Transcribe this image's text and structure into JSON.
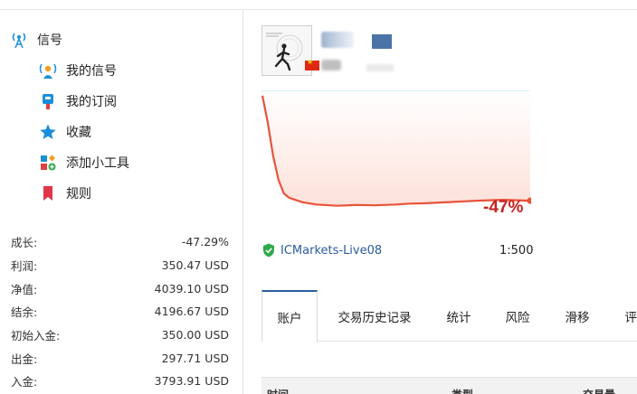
{
  "sidebar": {
    "header": {
      "label": "信号",
      "icon": "signal-antenna-icon"
    },
    "items": [
      {
        "label": "我的信号",
        "icon": "my-signals-icon"
      },
      {
        "label": "我的订阅",
        "icon": "subscriptions-icon"
      },
      {
        "label": "收藏",
        "icon": "star-icon"
      },
      {
        "label": "添加小工具",
        "icon": "add-widget-icon"
      },
      {
        "label": "规则",
        "icon": "bookmark-icon"
      }
    ]
  },
  "stats": [
    {
      "label": "成长:",
      "value": "-47.29%"
    },
    {
      "label": "利润:",
      "value": "350.47 USD"
    },
    {
      "label": "净值:",
      "value": "4039.10 USD"
    },
    {
      "label": "结余:",
      "value": "4196.67 USD"
    },
    {
      "label": "初始入金:",
      "value": "350.00 USD"
    },
    {
      "label": "出金:",
      "value": "297.71 USD"
    },
    {
      "label": "入金:",
      "value": "3793.91 USD"
    }
  ],
  "signal": {
    "country_flag": "china-flag-icon",
    "broker": "ICMarkets-Live08",
    "leverage": "1:500"
  },
  "chart_data": {
    "type": "area",
    "growth_label": "-47%",
    "x": [
      0,
      2,
      4,
      6,
      8,
      10,
      15,
      20,
      28,
      35,
      42,
      50,
      55,
      60,
      70,
      80,
      90,
      100
    ],
    "values": [
      0,
      -12,
      -27,
      -38,
      -44,
      -46,
      -48,
      -49,
      -49.6,
      -49.2,
      -49.4,
      -49,
      -48.6,
      -48.5,
      -47.9,
      -47.3,
      -46.9,
      -47.3
    ],
    "ylim": [
      -55,
      2
    ],
    "colors": {
      "line": "#e8533a",
      "fill_top": "#ffffff",
      "fill_bottom": "#fde2da",
      "baseline": "#d9eef7"
    }
  },
  "tabs": [
    {
      "label": "账户",
      "active": true
    },
    {
      "label": "交易历史记录",
      "active": false
    },
    {
      "label": "统计",
      "active": false
    },
    {
      "label": "风险",
      "active": false
    },
    {
      "label": "滑移",
      "active": false
    },
    {
      "label": "评",
      "active": false
    }
  ],
  "table": {
    "columns": [
      "时间",
      "类型",
      "交易量"
    ]
  }
}
